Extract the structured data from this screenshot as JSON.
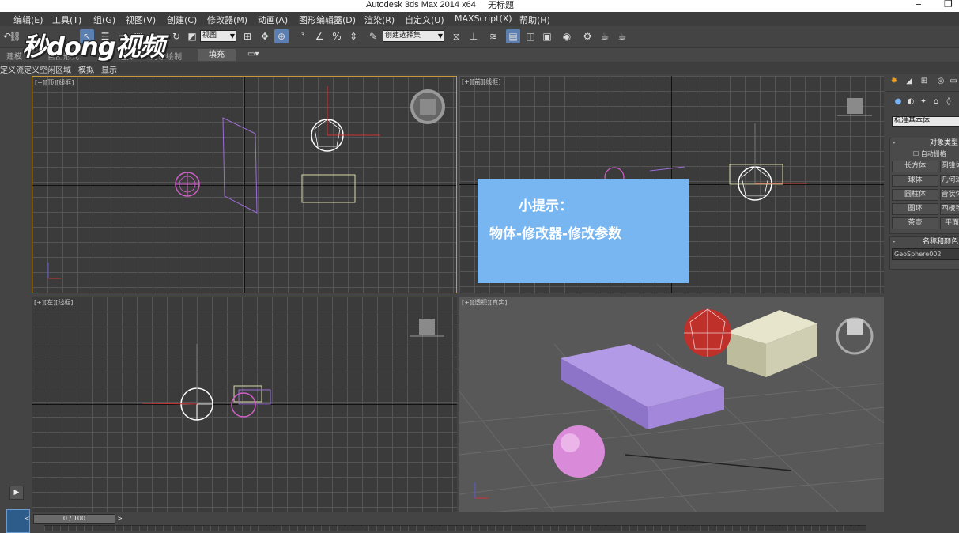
{
  "window": {
    "title": "Autodesk 3ds Max  2014 x64",
    "doc_title": "无标题"
  },
  "menu": [
    "编辑(E)",
    "工具(T)",
    "组(G)",
    "视图(V)",
    "创建(C)",
    "修改器(M)",
    "动画(A)",
    "图形编辑器(D)",
    "渲染(R)",
    "自定义(U)",
    "MAXScript(X)",
    "帮助(H)"
  ],
  "toolbar": {
    "view_dropdown": "视图",
    "selection_set_placeholder": "创建选择集"
  },
  "ribbon": {
    "tabs": [
      "建模",
      "自由形式",
      "选择",
      "对象绘制",
      "填充"
    ],
    "active_tab": "填充"
  },
  "subribbon": [
    "定义流",
    "定义空闲区域",
    "模拟",
    "显示"
  ],
  "logo_text": "秒dong视频",
  "viewports": {
    "top": "[+][顶][线框]",
    "front": "[+][前][线框]",
    "left": "[+][左][线框]",
    "perspective": "[+][透视][真实]"
  },
  "tip": {
    "title": "小提示：",
    "body": "物体-修改器-修改参数"
  },
  "command_panel": {
    "category_dropdown": "标准基本体",
    "object_type": {
      "header": "对象类型",
      "autogrid": "自动栅格",
      "buttons": [
        "长方体",
        "圆锥体",
        "球体",
        "几何球体",
        "圆柱体",
        "管状体",
        "圆环",
        "四棱锥",
        "茶壶",
        "平面"
      ]
    },
    "name_color": {
      "header": "名称和颜色",
      "name_value": "GeoSphere002"
    }
  },
  "timeline": {
    "frame_counter": "0 / 100"
  },
  "colors": {
    "viewport_bg": "#3b3b3b",
    "active_border": "#c89a3b",
    "tip_bg": "#78b6f2",
    "box_color": "#a98be0",
    "sphere_color": "#d98ad8",
    "geosphere_color": "#c0302a",
    "box2_color": "#d9d8b8"
  }
}
